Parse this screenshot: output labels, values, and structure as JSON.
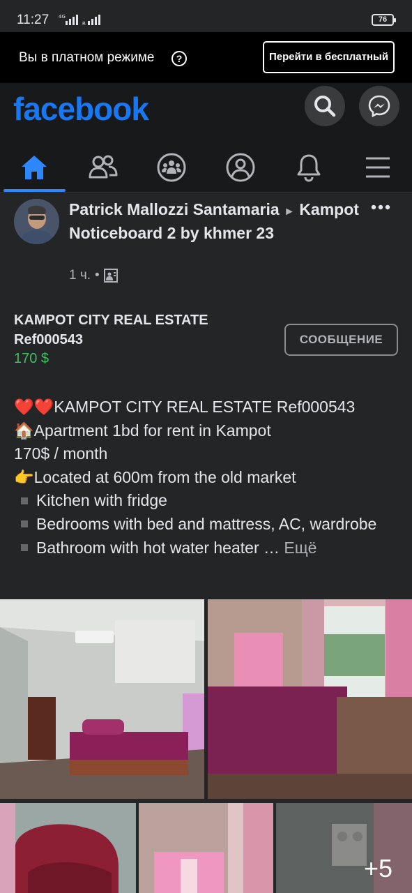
{
  "status_bar": {
    "time": "11:27",
    "battery": "76"
  },
  "paid_banner": {
    "text": "Вы в платном режиме",
    "help_icon": "help-icon",
    "button": "Перейти в бесплатный"
  },
  "header": {
    "logo": "facebook",
    "icons": [
      "search-icon",
      "messenger-icon"
    ],
    "nav_tabs": [
      {
        "name": "home-icon",
        "active": true
      },
      {
        "name": "friends-icon",
        "active": false
      },
      {
        "name": "groups-icon",
        "active": false
      },
      {
        "name": "profile-icon",
        "active": false
      },
      {
        "name": "notifications-icon",
        "active": false
      },
      {
        "name": "menu-icon",
        "active": false
      }
    ]
  },
  "post": {
    "author": "Patrick Mallozzi Santamaria",
    "arrow": "►",
    "group": "Kampot Noticeboard 2 by khmer 23",
    "time": "1 ч.",
    "separator": "•",
    "listing_title": "KAMPOT CITY REAL ESTATE Ref000543",
    "price": "170 $",
    "message_button": "СООБЩЕНИЕ",
    "body": {
      "line1_emoji": "❤️❤️",
      "line1": "KAMPOT CITY REAL ESTATE Ref000543",
      "line2_emoji": "🏠",
      "line2": "Apartment 1bd for rent in Kampot",
      "line3": "170$ / month",
      "line4_emoji": "👉",
      "line4": "Located at 600m from the old market",
      "line5": "Kitchen with fridge",
      "line6": "Bedrooms with bed and mattress, AC, wardrobe",
      "line7": "Bathroom with hot water heater …",
      "more_link": "Ещё"
    },
    "more_photos": "+5"
  },
  "colors": {
    "accent": "#1877f2",
    "price": "#45bd62",
    "background": "#18191a",
    "card": "#242526"
  }
}
